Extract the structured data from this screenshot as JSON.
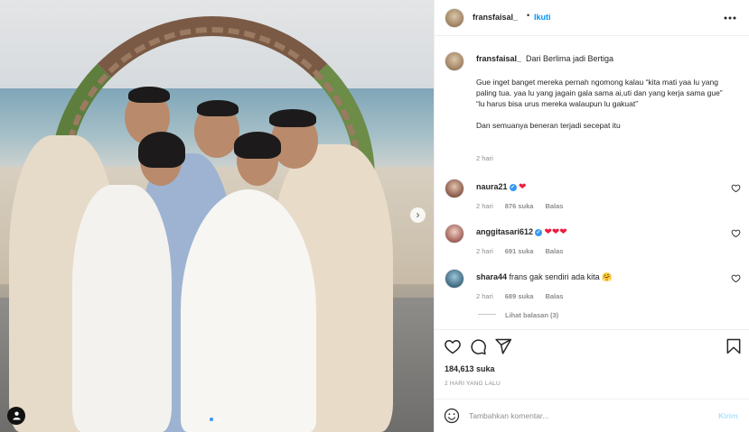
{
  "post": {
    "photo_alt": "",
    "carousel": {
      "dots": 2,
      "active": 0
    }
  },
  "header": {
    "username": "fransfaisal_",
    "separator": "•",
    "follow_label": "Ikuti"
  },
  "caption": {
    "username": "fransfaisal_",
    "title": "Dari Berlima jadi Bertiga",
    "lines": [
      "Gue inget banget mereka pernah ngomong kalau “kita mati yaa lu yang paling tua. yaa lu yang jagain gala sama ai,uti dan yang kerja sama gue”",
      "“lu harus bisa urus mereka walaupun lu gakuat”",
      "Dan semuanya beneran terjadi secepat itu"
    ],
    "time": "2 hari"
  },
  "comments": [
    {
      "username": "naura21",
      "verified": true,
      "text": "❤",
      "time": "2 hari",
      "likes": "876 suka",
      "reply": "Balas"
    },
    {
      "username": "anggitasari612",
      "verified": true,
      "text": "❤❤❤",
      "time": "2 hari",
      "likes": "691 suka",
      "reply": "Balas"
    },
    {
      "username": "shara44",
      "verified": false,
      "text": "frans gak sendiri ada kita 🤗",
      "time": "2 hari",
      "likes": "689 suka",
      "reply": "Balas"
    }
  ],
  "view_replies": "Lihat balasan (3)",
  "actions": {
    "likes": "184,613 suka",
    "date": "2 HARI YANG LALU"
  },
  "add_comment": {
    "placeholder": "Tambahkan komentar...",
    "post_label": "Kirim"
  },
  "colors": {
    "accent": "#0095f6",
    "heart": "#ed1c3c",
    "muted": "#8e8e8e",
    "post_disabled": "#b2dffc"
  },
  "icons": [
    "next-arrow-icon",
    "tag-user-icon",
    "more-options-icon",
    "heart-icon",
    "comment-icon",
    "share-icon",
    "bookmark-icon",
    "emoji-icon",
    "verified-badge-icon"
  ]
}
